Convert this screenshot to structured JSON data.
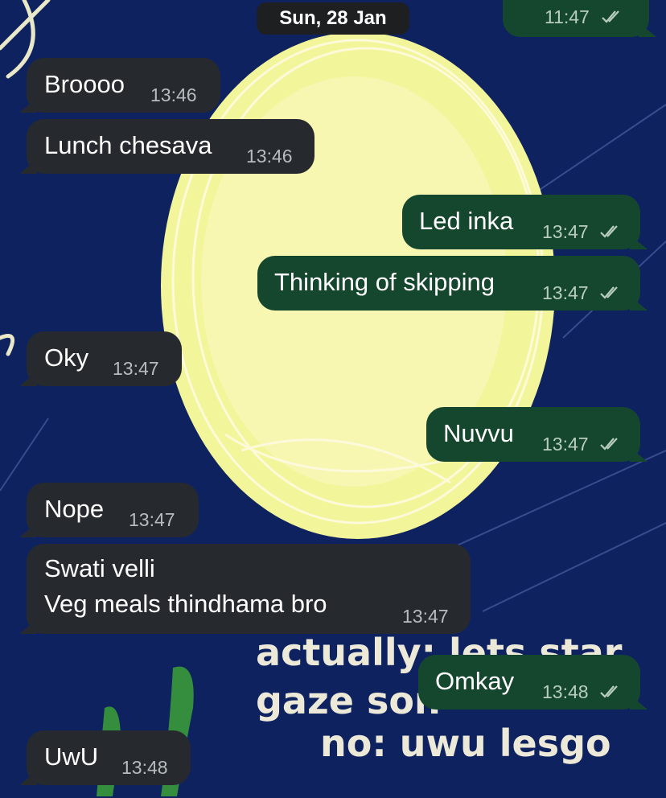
{
  "chat": {
    "date_separator": "Sun, 28 Jan",
    "wallpaper_doodle_lines": [
      "actually: lets star",
      "gaze son",
      "no: uwu lesgo"
    ],
    "colors": {
      "background": "#0f2260",
      "incoming_bubble": "#262a2e",
      "outgoing_bubble": "#15472f",
      "moon": "#f3f59a"
    },
    "messages": [
      {
        "direction": "outgoing",
        "text": "",
        "time": "11:47",
        "status": "read-double-tick"
      },
      {
        "direction": "incoming",
        "text": "Broooo",
        "time": "13:46"
      },
      {
        "direction": "incoming",
        "text": "Lunch chesava",
        "time": "13:46"
      },
      {
        "direction": "outgoing",
        "text": "Led inka",
        "time": "13:47",
        "status": "read-double-tick"
      },
      {
        "direction": "outgoing",
        "text": "Thinking of skipping",
        "time": "13:47",
        "status": "read-double-tick"
      },
      {
        "direction": "incoming",
        "text": "Oky",
        "time": "13:47"
      },
      {
        "direction": "outgoing",
        "text": "Nuvvu",
        "time": "13:47",
        "status": "read-double-tick"
      },
      {
        "direction": "incoming",
        "text": "Nope",
        "time": "13:47"
      },
      {
        "direction": "incoming",
        "lines": [
          "Swati velli",
          "Veg meals thindhama bro"
        ],
        "time": "13:47"
      },
      {
        "direction": "outgoing",
        "text": "Omkay",
        "time": "13:48",
        "status": "read-double-tick"
      },
      {
        "direction": "incoming",
        "text": "UwU",
        "time": "13:48"
      }
    ]
  }
}
